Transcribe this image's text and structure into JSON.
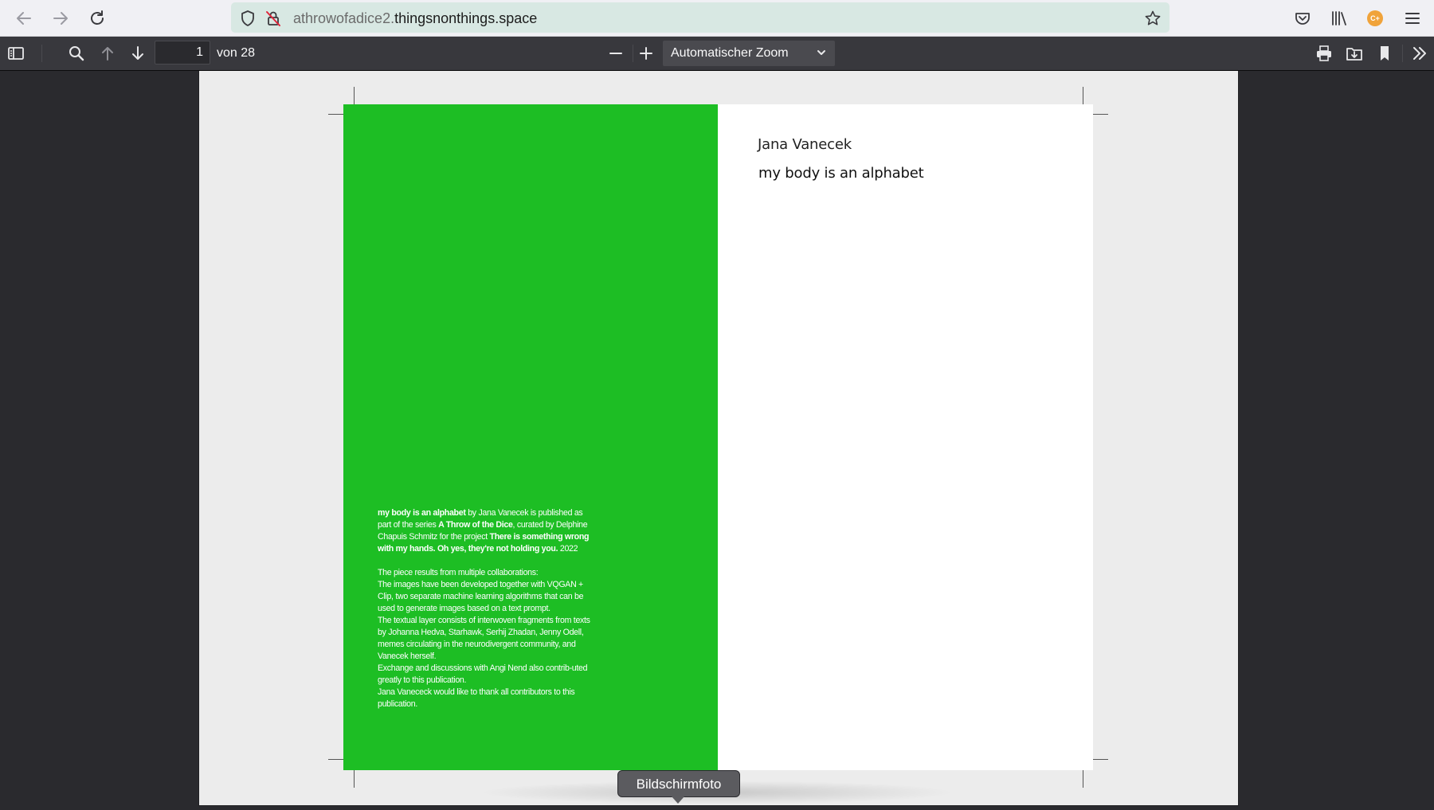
{
  "browser": {
    "url_prefix": "athrowofadice2.",
    "url_domain": "thingsnonthings.space",
    "extension_badge": "C+"
  },
  "pdf_toolbar": {
    "page_current": "1",
    "page_count_label": "von 28",
    "zoom_value": "Automatischer Zoom"
  },
  "document": {
    "author": "Jana Vanecek",
    "title": "my body is an alphabet",
    "colophon": {
      "p1_bold1": "my body is an alphabet",
      "p1_t1": " by Jana Vanecek is published as part of the series ",
      "p1_bold2": "A Throw of the Dice",
      "p1_t2": ", curated by Delphine Chapuis Schmitz for the project ",
      "p1_bold3": "There is something wrong with my hands. Oh yes, they're not holding you.",
      "p1_t3": " 2022",
      "p2_lines": [
        "The piece results from multiple collaborations:",
        "The images have been developed together with VQGAN + Clip, two separate machine learning algorithms that can be used to generate images based on a text prompt.",
        "The textual layer consists of interwoven fragments from texts by Johanna Hedva, Starhawk, Serhij Zhadan, Jenny Odell, memes circulating in the neurodivergent community, and Vanecek herself.",
        "Exchange and discussions with Angi Nend also contrib-uted greatly to this publication.",
        "Jana Vanececk would like to thank all contributors to this publication."
      ]
    }
  },
  "tooltip": {
    "label": "Bildschirmfoto"
  },
  "colors": {
    "green_panel": "#1dbe24",
    "pdf_toolbar": "#38383d",
    "url_bar": "#d8e8e3"
  }
}
